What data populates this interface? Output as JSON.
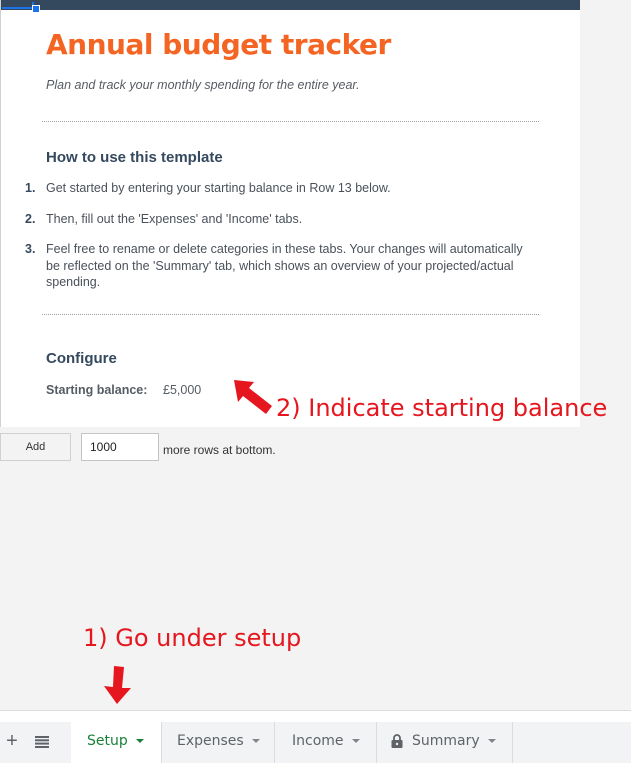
{
  "sheet": {
    "title": "Annual budget tracker",
    "subtitle": "Plan and track your monthly spending for the entire year.",
    "how_to": {
      "heading": "How to use this template",
      "steps": [
        {
          "num": "1.",
          "text": "Get started by entering your starting balance in Row 13 below."
        },
        {
          "num": "2.",
          "text": "Then, fill out the 'Expenses' and 'Income' tabs."
        },
        {
          "num": "3.",
          "text": "Feel free to rename or delete categories in these tabs. Your changes will automatically be reflected on the 'Summary' tab, which shows an overview of your projected/actual spending."
        }
      ]
    },
    "configure": {
      "heading": "Configure",
      "balance_label": "Starting balance:",
      "balance_value": "£5,000"
    }
  },
  "add_rows": {
    "button_label": "Add",
    "count_value": "1000",
    "suffix_text": "more rows at bottom."
  },
  "annotations": {
    "step1": "1) Go under setup",
    "step2": "2) Indicate starting balance",
    "color": "#e5161e"
  },
  "tabbar": {
    "add_icon": "plus-icon",
    "list_icon": "all-sheets-icon",
    "tabs": [
      {
        "label": "Setup",
        "active": true
      },
      {
        "label": "Expenses",
        "active": false
      },
      {
        "label": "Income",
        "active": false
      },
      {
        "label": "Summary",
        "active": false,
        "locked": true
      }
    ]
  },
  "colors": {
    "title": "#f46524",
    "header_bar": "#35495e",
    "active_tab": "#188038"
  }
}
